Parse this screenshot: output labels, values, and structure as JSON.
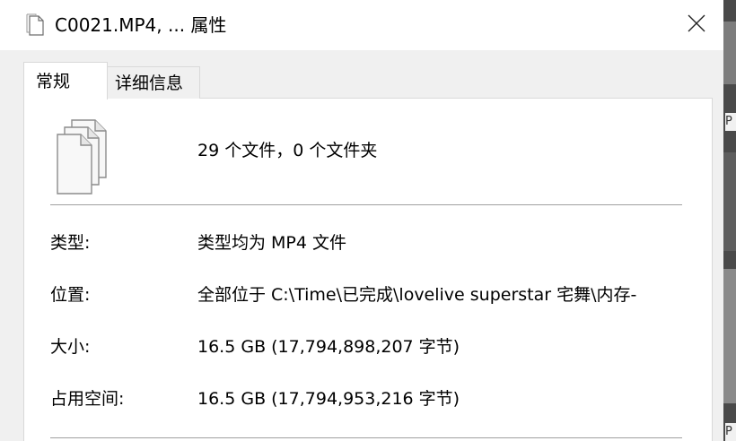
{
  "window": {
    "title": "C0021.MP4, ... 属性",
    "title_icon": "document-icon",
    "close_icon": "close-icon"
  },
  "tabs": [
    {
      "label": "常规",
      "selected": true
    },
    {
      "label": "详细信息",
      "selected": false
    }
  ],
  "summary": {
    "icon": "multiple-files-icon",
    "text": "29 个文件，0 个文件夹"
  },
  "properties": [
    {
      "label": "类型:",
      "value": "类型均为 MP4 文件"
    },
    {
      "label": "位置:",
      "value": "全部位于 C:\\Time\\已完成\\lovelive superstar 宅舞\\内存-"
    },
    {
      "label": "大小:",
      "value": "16.5 GB (17,794,898,207 字节)"
    },
    {
      "label": "占用空间:",
      "value": "16.5 GB (17,794,953,216 字节)"
    }
  ],
  "background": {
    "letters": [
      "P",
      "P"
    ]
  },
  "colors": {
    "dialog_bg": "#f0f0f0",
    "panel_bg": "#ffffff",
    "divider": "#a0a0a0"
  }
}
